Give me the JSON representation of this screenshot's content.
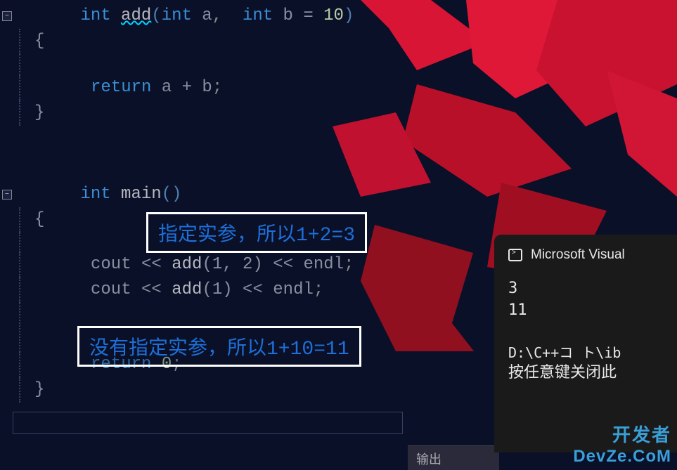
{
  "code": {
    "line1": {
      "kw1": "int",
      "fn": "add",
      "paren_open": "(",
      "kw2": "int",
      "param1": " a",
      "comma": ",",
      "kw3": "  int",
      "param2": " b ",
      "eq": "=",
      "val": " 10",
      "paren_close": ")"
    },
    "line2_brace": "{",
    "line3": {
      "kw": "return",
      "expr": " a + b",
      "semi": ";"
    },
    "line4_brace": "}",
    "line5": {
      "kw": "int",
      "fn": " main",
      "parens": "()"
    },
    "line6_brace": "{",
    "line7": {
      "stream": "cout ",
      "op1": "<<",
      "fn": " add",
      "args": "(1, 2) ",
      "op2": "<<",
      "endl": " endl",
      "semi": ";"
    },
    "line8": {
      "stream": "cout ",
      "op1": "<<",
      "fn": " add",
      "args": "(1) ",
      "op2": "<<",
      "endl": " endl",
      "semi": ";"
    },
    "line10": {
      "kw": "return",
      "val": " 0",
      "semi": ";"
    },
    "line11_brace": "}"
  },
  "annotations": {
    "anno1": "指定实参，所以1+2=3",
    "anno2": "没有指定实参，所以1+10=11"
  },
  "terminal": {
    "title": "Microsoft Visual",
    "output1": "3",
    "output2": "11",
    "path": "D:\\C++コ ト\\ib",
    "close_msg": "按任意键关闭此"
  },
  "output_panel": {
    "label": "输出"
  },
  "watermark": {
    "line1": "开发者",
    "line2": "DevZe.CoM"
  },
  "fold_symbol": "−"
}
